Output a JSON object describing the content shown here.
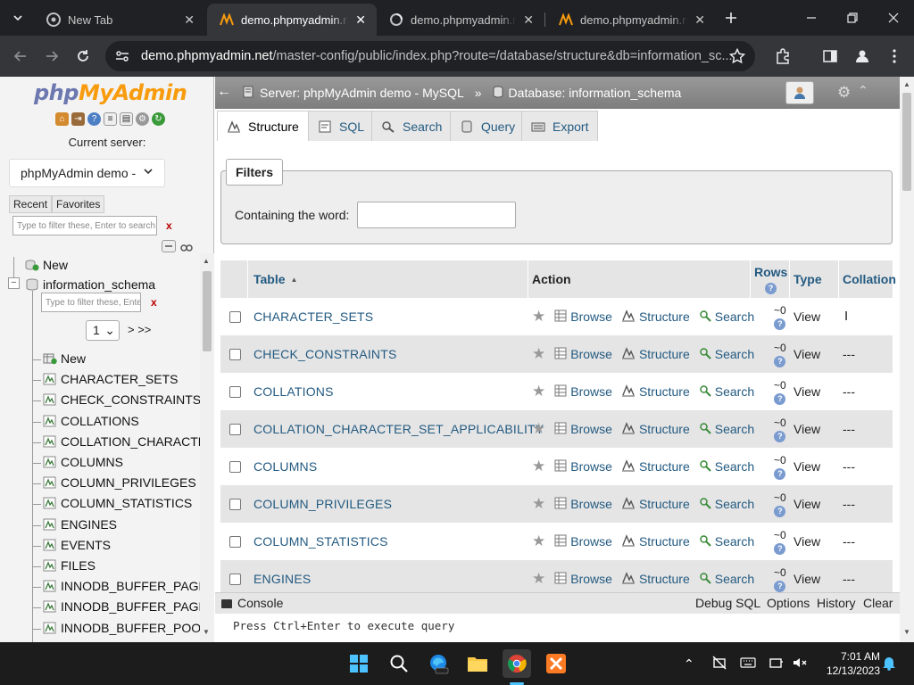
{
  "browser": {
    "tabs": [
      {
        "title": "New Tab",
        "icon": "chrome-icon"
      },
      {
        "title": "demo.phpmyadmin.ne",
        "icon": "phpmyadmin-icon",
        "active": true
      },
      {
        "title": "demo.phpmyadmin.ne",
        "icon": "loading-icon"
      },
      {
        "title": "demo.phpmyadmin.ne",
        "icon": "phpmyadmin-icon"
      }
    ],
    "url_host": "demo.phpmyadmin.net",
    "url_path": "/master-config/public/index.php?route=/database/structure&db=information_sc..."
  },
  "sidebar": {
    "logo_php": "php",
    "logo_myadmin": "MyAdmin",
    "current_server_label": "Current server:",
    "server_select": "phpMyAdmin demo - ",
    "recent_label": "Recent",
    "favorites_label": "Favorites",
    "filter_placeholder": "Type to filter these, Enter to search al",
    "x_label": "x",
    "tree_new": "New",
    "db_name": "information_schema",
    "db_filter_placeholder": "Type to filter these, Enter",
    "page_select": "1",
    "page_next": "> >>",
    "tables": [
      "New",
      "CHARACTER_SETS",
      "CHECK_CONSTRAINTS",
      "COLLATIONS",
      "COLLATION_CHARACTE",
      "COLUMNS",
      "COLUMN_PRIVILEGES",
      "COLUMN_STATISTICS",
      "ENGINES",
      "EVENTS",
      "FILES",
      "INNODB_BUFFER_PAGE",
      "INNODB_BUFFER_PAGE",
      "INNODB_BUFFER_POOL"
    ]
  },
  "main": {
    "breadcrumb_server": "Server: phpMyAdmin demo - MySQL",
    "breadcrumb_sep": "»",
    "breadcrumb_db": "Database: information_schema",
    "tabs": [
      "Structure",
      "SQL",
      "Search",
      "Query",
      "Export"
    ],
    "filters_legend": "Filters",
    "filters_label": "Containing the word:",
    "columns": {
      "table": "Table",
      "sort": "▲",
      "action": "Action",
      "rows": "Rows",
      "type": "Type",
      "collation": "Collation"
    },
    "action_labels": {
      "browse": "Browse",
      "structure": "Structure",
      "search": "Search"
    },
    "rows": [
      {
        "name": "CHARACTER_SETS",
        "rows": "~0",
        "type": "View",
        "collation": ""
      },
      {
        "name": "CHECK_CONSTRAINTS",
        "rows": "~0",
        "type": "View",
        "collation": "---"
      },
      {
        "name": "COLLATIONS",
        "rows": "~0",
        "type": "View",
        "collation": "---"
      },
      {
        "name": "COLLATION_CHARACTER_SET_APPLICABILITY",
        "rows": "~0",
        "type": "View",
        "collation": "---"
      },
      {
        "name": "COLUMNS",
        "rows": "~0",
        "type": "View",
        "collation": "---"
      },
      {
        "name": "COLUMN_PRIVILEGES",
        "rows": "~0",
        "type": "View",
        "collation": "---"
      },
      {
        "name": "COLUMN_STATISTICS",
        "rows": "~0",
        "type": "View",
        "collation": "---"
      },
      {
        "name": "ENGINES",
        "rows": "~0",
        "type": "View",
        "collation": "---"
      }
    ],
    "console": {
      "label": "Console",
      "debug": "Debug SQL",
      "options": "Options",
      "history": "History",
      "clear": "Clear",
      "prompt": "Press Ctrl+Enter to execute query"
    }
  },
  "taskbar": {
    "time": "7:01 AM",
    "date": "12/13/2023"
  },
  "colors": {
    "link": "#235a81",
    "logo_blue": "#6c78af",
    "logo_orange": "#f89c0e"
  }
}
